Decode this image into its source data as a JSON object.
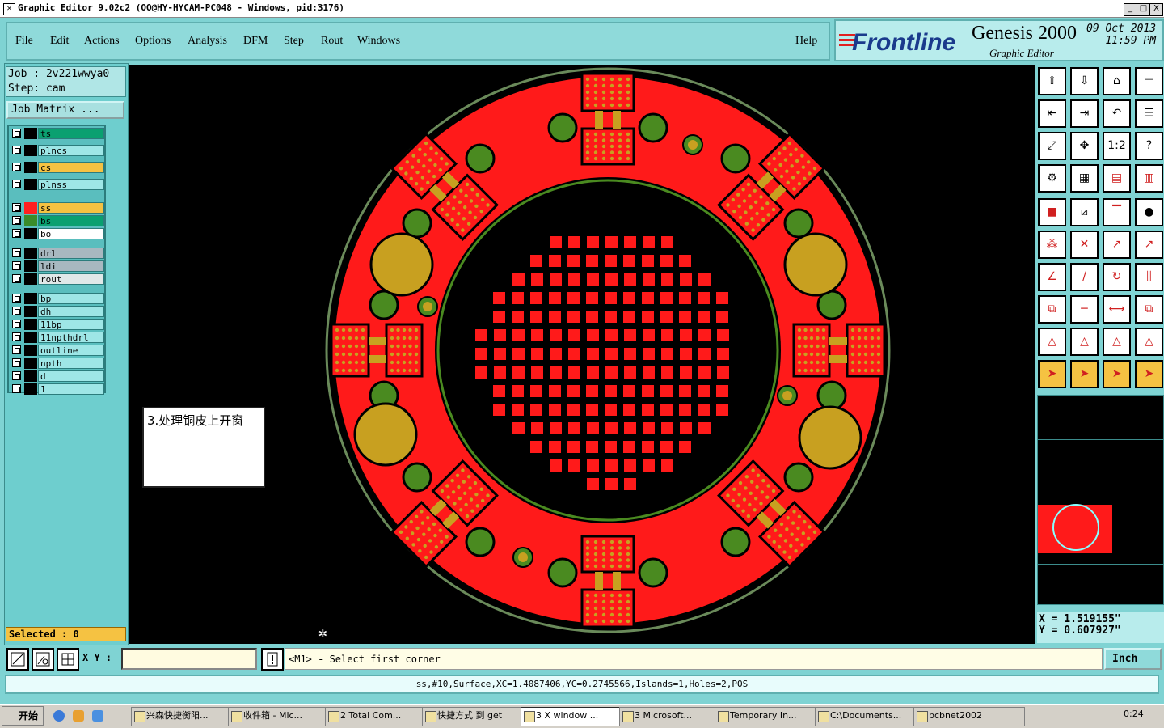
{
  "window": {
    "title": "Graphic Editor 9.02c2  (OO@HY-HYCAM-PC048 - Windows, pid:3176)",
    "min": "_",
    "max": "□",
    "close": "X"
  },
  "menu": {
    "items": [
      "File",
      "Edit",
      "Actions",
      "Options",
      "Analysis",
      "DFM",
      "Step",
      "Rout",
      "Windows"
    ],
    "help": "Help"
  },
  "brand": {
    "logo": "Frontline",
    "product": "Genesis 2000",
    "subtitle": "Graphic Editor",
    "date": "09 Oct 2013",
    "time": "11:59 PM"
  },
  "job": {
    "job_line": "Job : 2v221wwya0",
    "step_line": "Step: cam",
    "matrix_button": "Job Matrix ..."
  },
  "layers": [
    {
      "name": "ts",
      "color": "#0aa070",
      "swatch": "#000"
    },
    {
      "name": "plncs",
      "color": "#9ee6e6",
      "swatch": "#000"
    },
    {
      "name": "cs",
      "color": "#f5c242",
      "swatch": "#000"
    },
    {
      "name": "plnss",
      "color": "#9ee6e6",
      "swatch": "#000"
    },
    {
      "name": "ss",
      "color": "#f5c242",
      "swatch": "#ff2020"
    },
    {
      "name": "bs",
      "color": "#0aa070",
      "swatch": "#3a8c2a"
    },
    {
      "name": "bo",
      "color": "#ffffff",
      "swatch": "#000"
    },
    {
      "name": "drl",
      "color": "#a8b8c0",
      "swatch": "#000"
    },
    {
      "name": "ldi",
      "color": "#a8b8c0",
      "swatch": "#000"
    },
    {
      "name": "rout",
      "color": "#e0e8e8",
      "swatch": "#000"
    },
    {
      "name": "bp",
      "color": "#9ee6e6",
      "swatch": "#000"
    },
    {
      "name": "dh",
      "color": "#9ee6e6",
      "swatch": "#000"
    },
    {
      "name": "11bp",
      "color": "#9ee6e6",
      "swatch": "#000"
    },
    {
      "name": "11npthdrl",
      "color": "#9ee6e6",
      "swatch": "#000"
    },
    {
      "name": "outline",
      "color": "#9ee6e6",
      "swatch": "#000"
    },
    {
      "name": "npth",
      "color": "#9ee6e6",
      "swatch": "#000"
    },
    {
      "name": "d",
      "color": "#9ee6e6",
      "swatch": "#000"
    },
    {
      "name": "1",
      "color": "#9ee6e6",
      "swatch": "#000"
    }
  ],
  "selected": "Selected : 0",
  "note": "3.处理铜皮上开窗",
  "coords": {
    "x": "X = 1.519155\"",
    "y": "Y = 0.607927\""
  },
  "input": {
    "xy_label": "X Y :",
    "prompt": "<M1> - Select first corner",
    "units": "Inch"
  },
  "status": "ss,#10,Surface,XC=1.4087406,YC=0.2745566,Islands=1,Holes=2,POS",
  "taskbar": {
    "start": "开始",
    "tasks": [
      "兴森快捷衡阳...",
      "收件箱 - Mic...",
      "2 Total Com...",
      "快捷方式 到 get",
      "3 X window ...",
      "3 Microsoft...",
      "Temporary In...",
      "C:\\Documents...",
      "pcbnet2002"
    ],
    "clock": "0:24"
  },
  "colors": {
    "copper": "#ff1a1a",
    "pad_gold": "#c8a020",
    "ring_green": "#4a8a20",
    "canvas": "#000000"
  }
}
